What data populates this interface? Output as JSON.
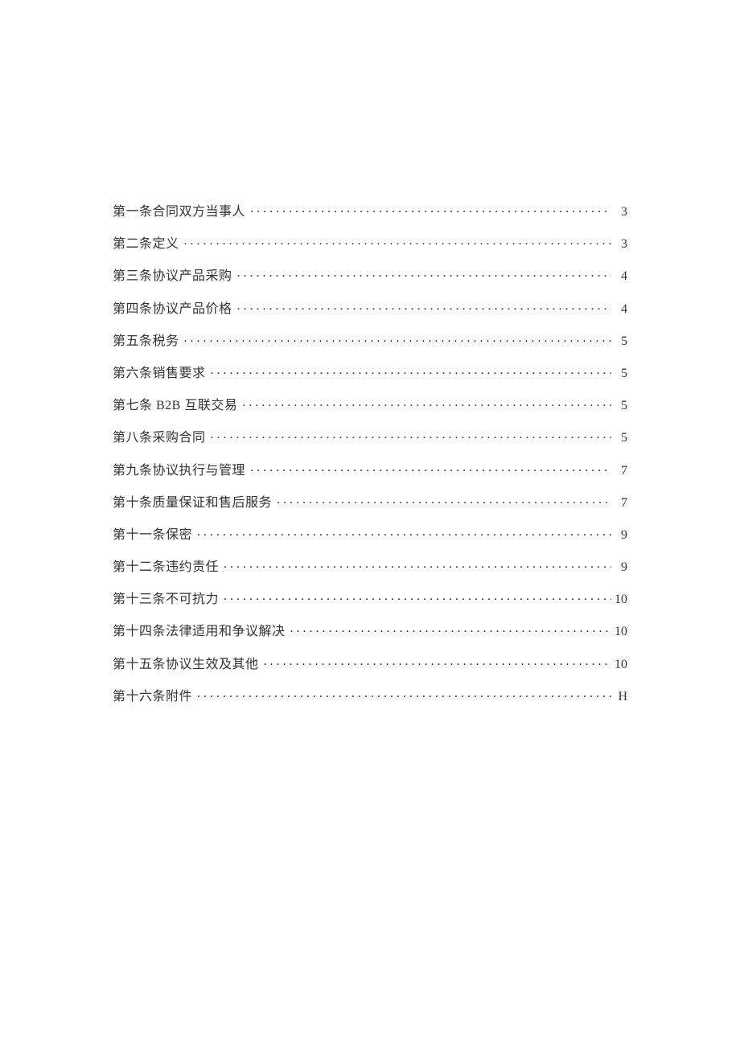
{
  "toc": {
    "entries": [
      {
        "title": "第一条合同双方当事人",
        "page": "3"
      },
      {
        "title": "第二条定义",
        "page": "3"
      },
      {
        "title": "第三条协议产品采购",
        "page": "4"
      },
      {
        "title": "第四条协议产品价格",
        "page": "4"
      },
      {
        "title": "第五条税务",
        "page": "5"
      },
      {
        "title": "第六条销售要求",
        "page": "5"
      },
      {
        "title": "第七条 B2B 互联交易",
        "page": "5"
      },
      {
        "title": "第八条采购合同",
        "page": "5"
      },
      {
        "title": "第九条协议执行与管理",
        "page": "7"
      },
      {
        "title": "第十条质量保证和售后服务",
        "page": "7"
      },
      {
        "title": "第十一条保密",
        "page": "9"
      },
      {
        "title": "第十二条违约责任",
        "page": "9"
      },
      {
        "title": "第十三条不可抗力",
        "page": "10"
      },
      {
        "title": "第十四条法律适用和争议解决",
        "page": "10"
      },
      {
        "title": "第十五条协议生效及其他",
        "page": "10"
      },
      {
        "title": "第十六条附件",
        "page": "H"
      }
    ]
  }
}
